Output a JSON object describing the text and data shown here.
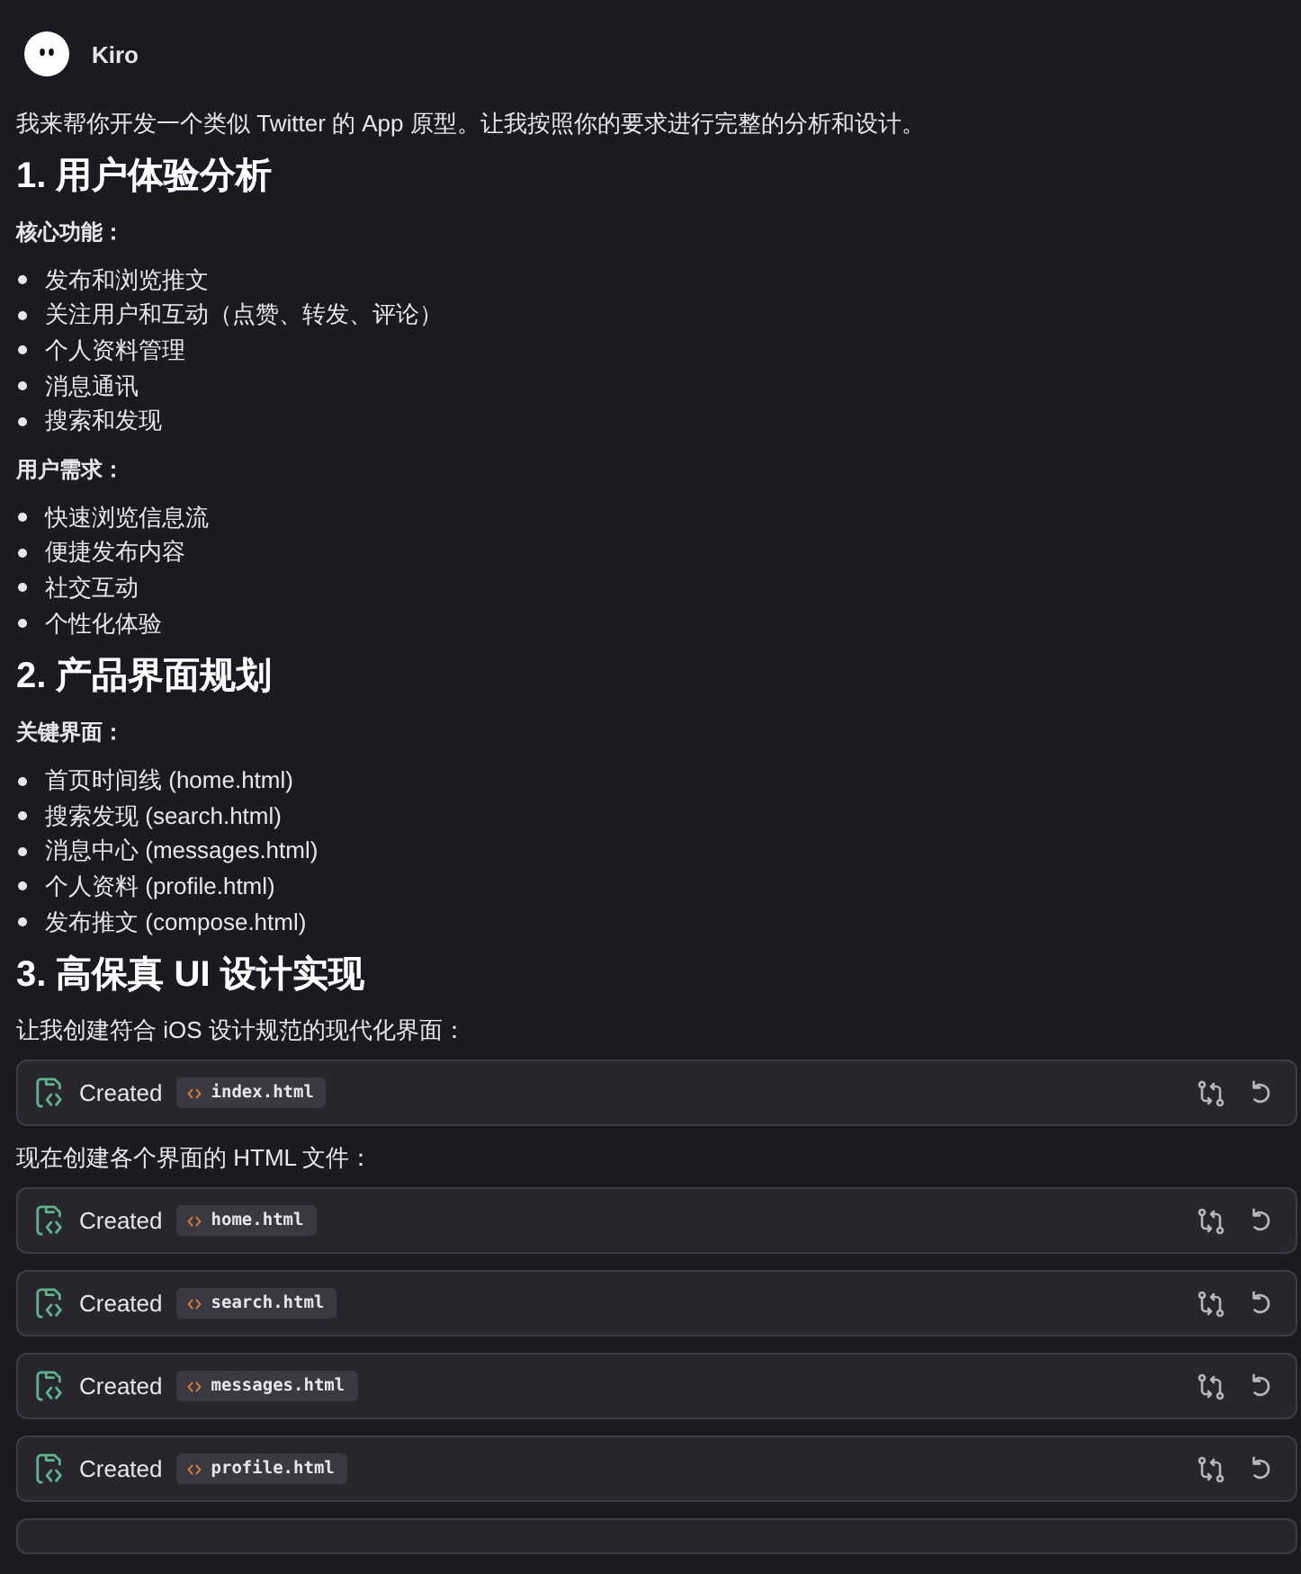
{
  "header": {
    "name": "Kiro"
  },
  "blocks": [
    {
      "kind": "paragraph",
      "text": "我来帮你开发一个类似 Twitter 的 App 原型。让我按照你的要求进行完整的分析和设计。"
    },
    {
      "kind": "heading",
      "text": "1. 用户体验分析"
    },
    {
      "kind": "label",
      "text": "核心功能："
    },
    {
      "kind": "list",
      "items": [
        "发布和浏览推文",
        "关注用户和互动（点赞、转发、评论）",
        "个人资料管理",
        "消息通讯",
        "搜索和发现"
      ]
    },
    {
      "kind": "label",
      "text": "用户需求："
    },
    {
      "kind": "list",
      "items": [
        "快速浏览信息流",
        "便捷发布内容",
        "社交互动",
        "个性化体验"
      ]
    },
    {
      "kind": "heading",
      "text": "2. 产品界面规划"
    },
    {
      "kind": "label",
      "text": "关键界面："
    },
    {
      "kind": "list",
      "items": [
        "首页时间线 (home.html)",
        "搜索发现 (search.html)",
        "消息中心 (messages.html)",
        "个人资料 (profile.html)",
        "发布推文 (compose.html)"
      ]
    },
    {
      "kind": "heading",
      "text": "3. 高保真 UI 设计实现"
    },
    {
      "kind": "paragraph",
      "text": "让我创建符合 iOS 设计规范的现代化界面："
    },
    {
      "kind": "file",
      "action": "Created",
      "file": "index.html"
    },
    {
      "kind": "paragraph",
      "text": "现在创建各个界面的 HTML 文件："
    },
    {
      "kind": "file",
      "action": "Created",
      "file": "home.html"
    },
    {
      "kind": "file",
      "action": "Created",
      "file": "search.html"
    },
    {
      "kind": "file",
      "action": "Created",
      "file": "messages.html"
    },
    {
      "kind": "file",
      "action": "Created",
      "file": "profile.html"
    }
  ]
}
